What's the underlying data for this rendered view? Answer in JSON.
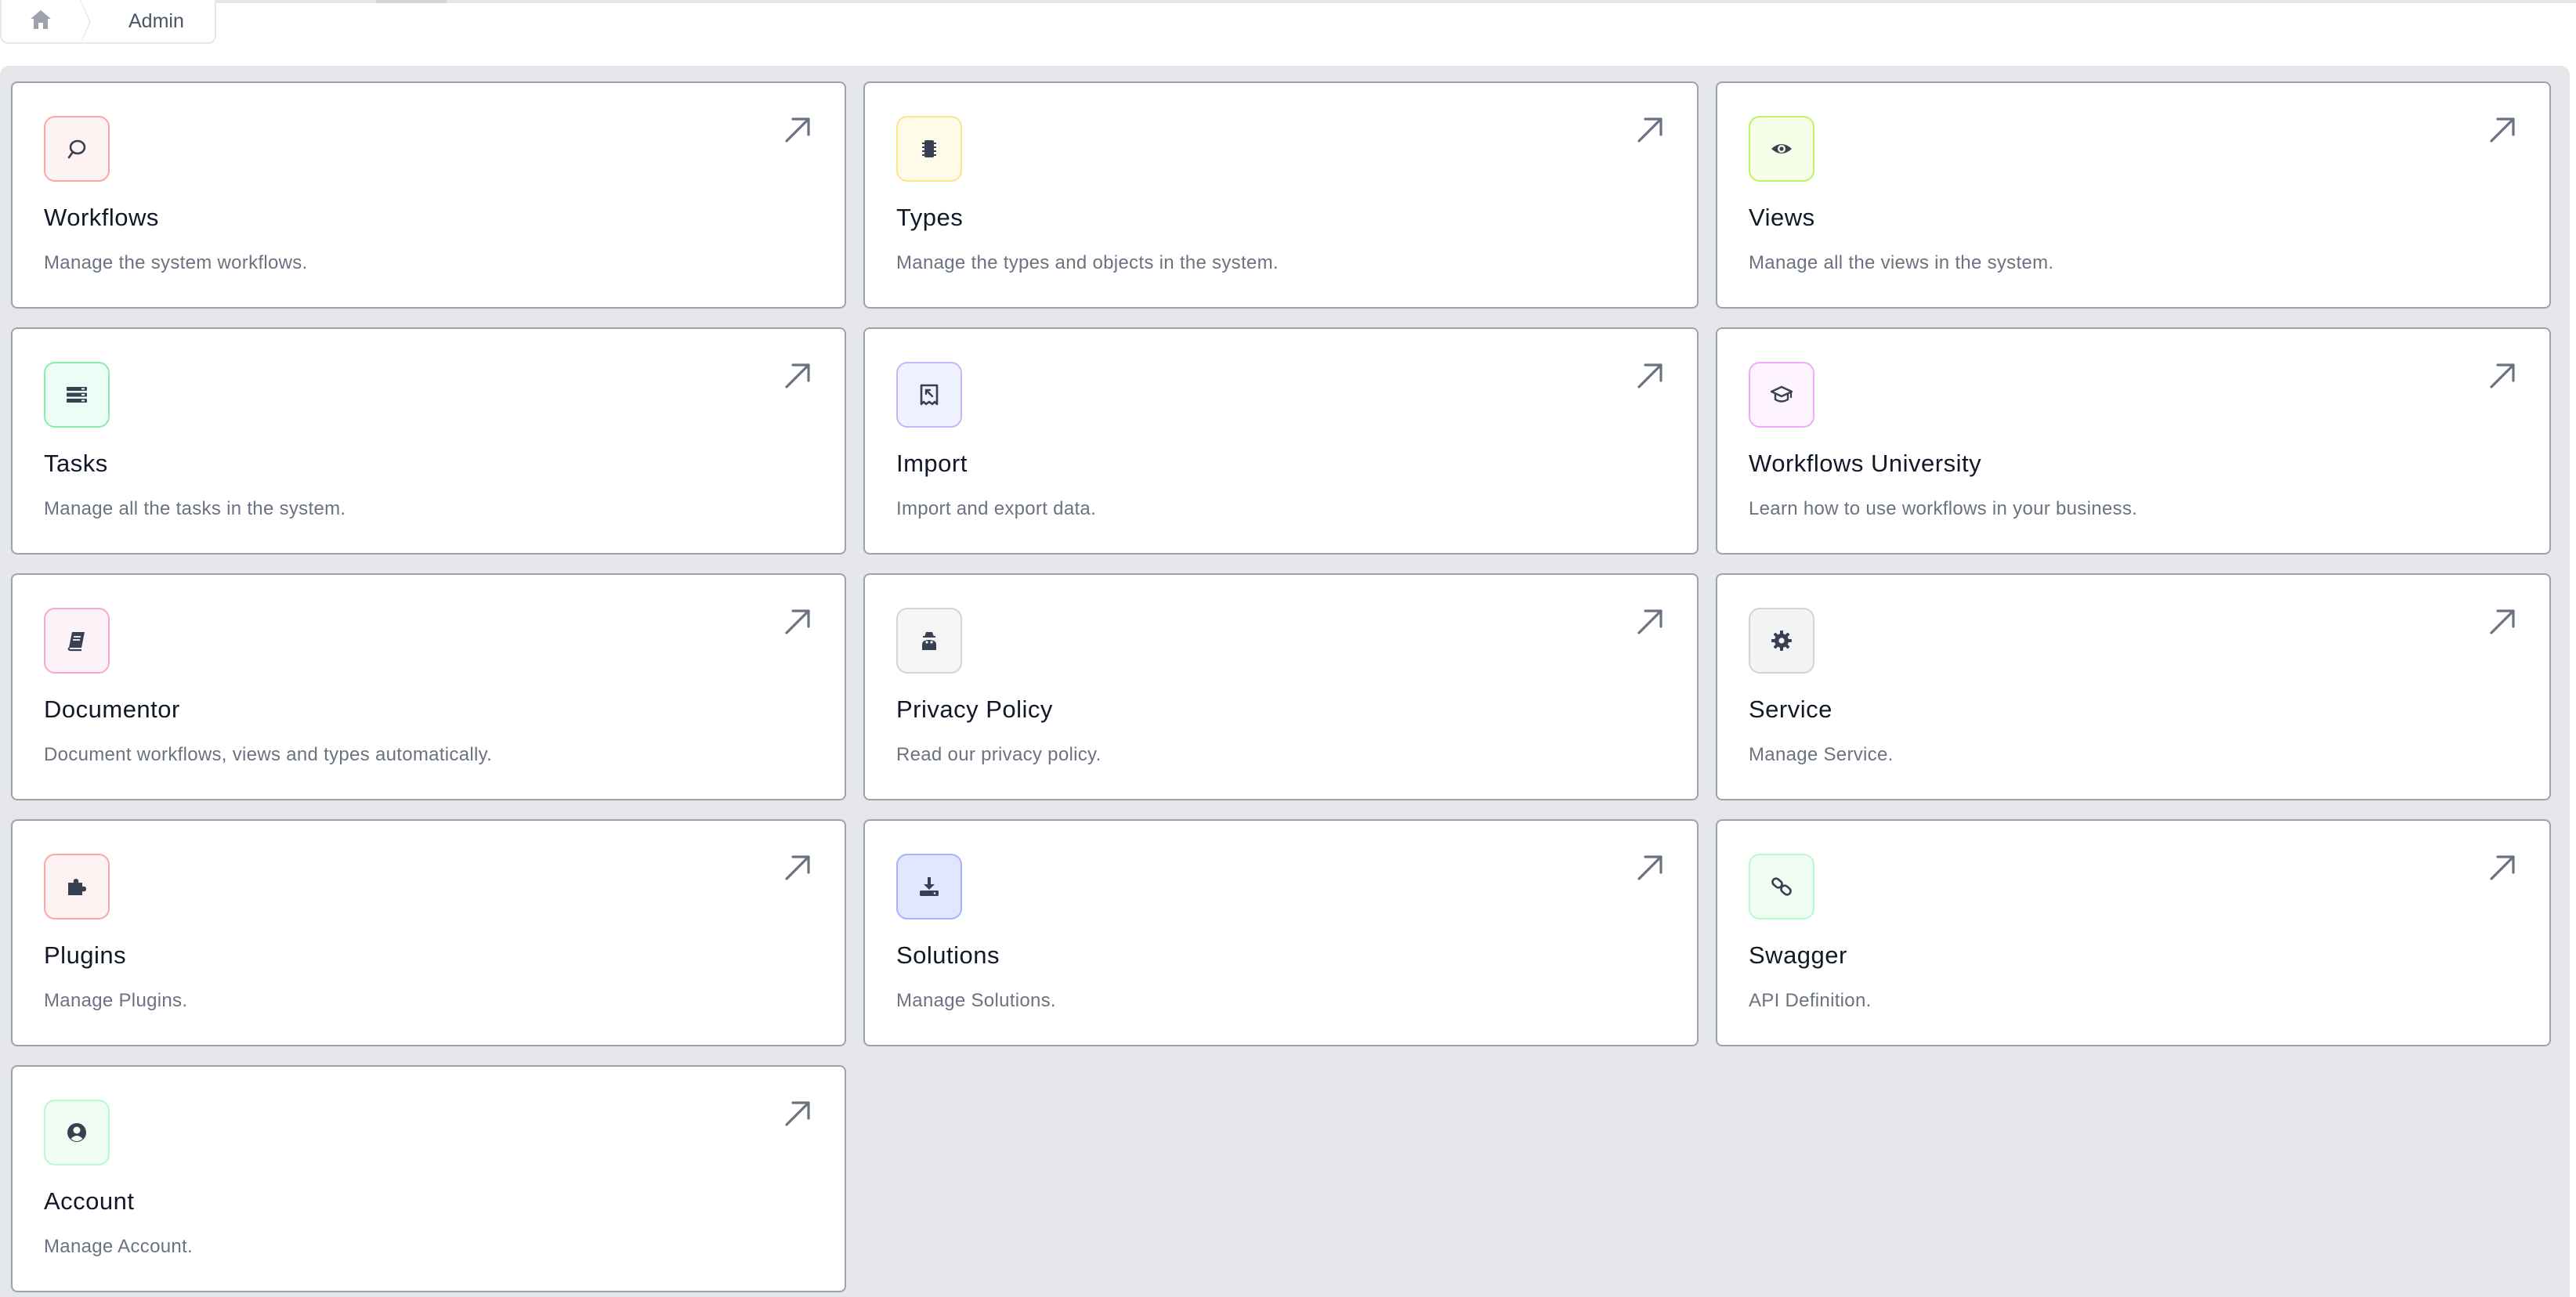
{
  "breadcrumb": {
    "home_icon": "home-icon",
    "current": "Admin"
  },
  "cards": [
    {
      "title": "Workflows",
      "description": "Manage the system workflows.",
      "icon": "workflow-icon",
      "icon_bg": "#fef2f2",
      "icon_border": "#fca5a5"
    },
    {
      "title": "Types",
      "description": "Manage the types and objects in the system.",
      "icon": "microchip-icon",
      "icon_bg": "#fefce8",
      "icon_border": "#fde68a"
    },
    {
      "title": "Views",
      "description": "Manage all the views in the system.",
      "icon": "eye-icon",
      "icon_bg": "#f7fee7",
      "icon_border": "#bef264"
    },
    {
      "title": "Tasks",
      "description": "Manage all the tasks in the system.",
      "icon": "server-icon",
      "icon_bg": "#ecfdf5",
      "icon_border": "#86efac"
    },
    {
      "title": "Import",
      "description": "Import and export data.",
      "icon": "import-receipt-icon",
      "icon_bg": "#eef2ff",
      "icon_border": "#c4b5fd"
    },
    {
      "title": "Workflows University",
      "description": "Learn how to use workflows in your business.",
      "icon": "graduation-cap-icon",
      "icon_bg": "#fdf4ff",
      "icon_border": "#f0abfc"
    },
    {
      "title": "Documentor",
      "description": "Document workflows, views and types automatically.",
      "icon": "book-icon",
      "icon_bg": "#fdf2f8",
      "icon_border": "#f9a8d4"
    },
    {
      "title": "Privacy Policy",
      "description": "Read our privacy policy.",
      "icon": "user-secret-icon",
      "icon_bg": "#f5f5f4",
      "icon_border": "#d6d3d1"
    },
    {
      "title": "Service",
      "description": "Manage Service.",
      "icon": "gear-icon",
      "icon_bg": "#f3f4f6",
      "icon_border": "#d1d5db"
    },
    {
      "title": "Plugins",
      "description": "Manage Plugins.",
      "icon": "puzzle-icon",
      "icon_bg": "#fef2f2",
      "icon_border": "#fca5a5"
    },
    {
      "title": "Solutions",
      "description": "Manage Solutions.",
      "icon": "download-tray-icon",
      "icon_bg": "#e0e7ff",
      "icon_border": "#a5b4fc"
    },
    {
      "title": "Swagger",
      "description": "API Definition.",
      "icon": "link-icon",
      "icon_bg": "#f0fdf4",
      "icon_border": "#bbf7d0"
    },
    {
      "title": "Account",
      "description": "Manage Account.",
      "icon": "user-circle-icon",
      "icon_bg": "#f0fdf4",
      "icon_border": "#bbf7d0"
    }
  ],
  "colors": {
    "panel_bg": "#e5e7eb",
    "card_border": "#9ca3af",
    "icon_glyph": "#374151",
    "arrow": "#6b7280"
  }
}
